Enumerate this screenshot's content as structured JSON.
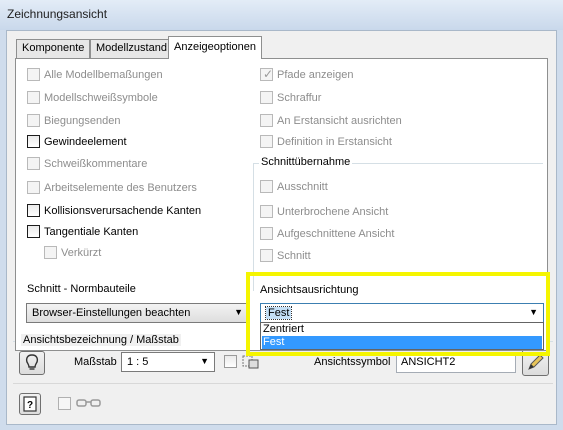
{
  "window": {
    "title": "Zeichnungsansicht"
  },
  "tabs": [
    {
      "label": "Komponente"
    },
    {
      "label": "Modellzustand"
    },
    {
      "label": "Anzeigeoptionen",
      "active": true
    }
  ],
  "left_checkboxes": [
    {
      "label": "Alle Modellbemaßungen",
      "checked": false,
      "enabled": false
    },
    {
      "label": "Modellschweißsymbole",
      "checked": false,
      "enabled": false
    },
    {
      "label": "Biegungsenden",
      "checked": false,
      "enabled": false
    },
    {
      "label": "Gewindeelement",
      "checked": false,
      "enabled": true
    },
    {
      "label": "Schweißkommentare",
      "checked": false,
      "enabled": false
    },
    {
      "label": "Arbeitselemente des Benutzers",
      "checked": false,
      "enabled": false
    },
    {
      "label": "Kollisionsverursachende Kanten",
      "checked": false,
      "enabled": true
    },
    {
      "label": "Tangentiale Kanten",
      "checked": false,
      "enabled": true
    },
    {
      "label": "Verkürzt",
      "checked": false,
      "enabled": false
    }
  ],
  "right_checkboxes": [
    {
      "label": "Pfade anzeigen",
      "checked": true,
      "enabled": false
    },
    {
      "label": "Schraffur",
      "checked": false,
      "enabled": false
    },
    {
      "label": "An Erstansicht ausrichten",
      "checked": false,
      "enabled": false
    },
    {
      "label": "Definition in Erstansicht",
      "checked": false,
      "enabled": false
    }
  ],
  "schnitt_group": {
    "title": "Schnittübernahme",
    "items": [
      {
        "label": "Ausschnitt",
        "checked": false,
        "enabled": false
      },
      {
        "label": "Unterbrochene Ansicht",
        "checked": false,
        "enabled": false
      },
      {
        "label": "Aufgeschnittene Ansicht",
        "checked": false,
        "enabled": false
      },
      {
        "label": "Schnitt",
        "checked": false,
        "enabled": false
      }
    ]
  },
  "normbauteile": {
    "label": "Schnitt - Normbauteile",
    "value": "Browser-Einstellungen beachten"
  },
  "ansichtsausrichtung": {
    "label": "Ansichtsausrichtung",
    "value": "Fest",
    "options": [
      "Zentriert",
      "Fest"
    ],
    "selected": "Fest"
  },
  "bezeichnung_group": {
    "title": "Ansichtsbezeichnung / Maßstab",
    "massstab_label": "Maßstab",
    "massstab_value": "1 : 5",
    "ansichtssymbol_label": "Ansichtssymbol",
    "ansichtssymbol_value": "ANSICHT2"
  },
  "icons": {
    "label_visibility": "bulb-icon",
    "edit_label": "pencil-icon",
    "help": "help-icon",
    "glasses": "glasses-icon"
  },
  "colors": {
    "highlight": "#f5f500",
    "selection": "#3399ff"
  }
}
